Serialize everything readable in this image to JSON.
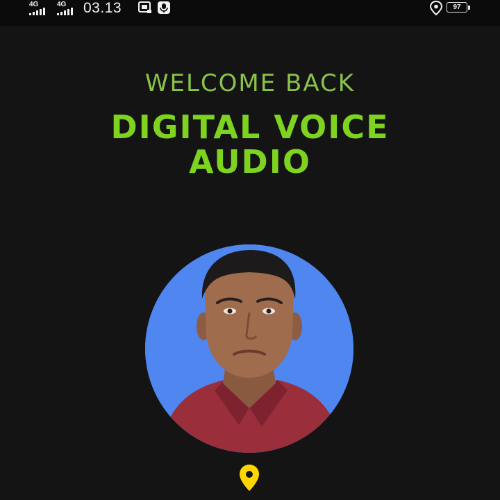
{
  "status_bar": {
    "signal_1_network": "4G",
    "signal_2_network": "4G",
    "time": "03.13",
    "battery_level": "97",
    "icons": [
      "signal-icon",
      "signal-icon",
      "screenshot-icon",
      "microphone-icon",
      "location-icon",
      "battery-icon"
    ]
  },
  "welcome": {
    "greeting": "WELCOME BACK",
    "app_title_line1": "DIGITAL VOICE",
    "app_title_line2": "AUDIO"
  },
  "profile": {
    "avatar_background": "#4f86f0",
    "location_pin_color": "#ffd600"
  },
  "colors": {
    "background": "#141414",
    "greeting_green": "#8bc34a",
    "title_green": "#7ed321"
  }
}
